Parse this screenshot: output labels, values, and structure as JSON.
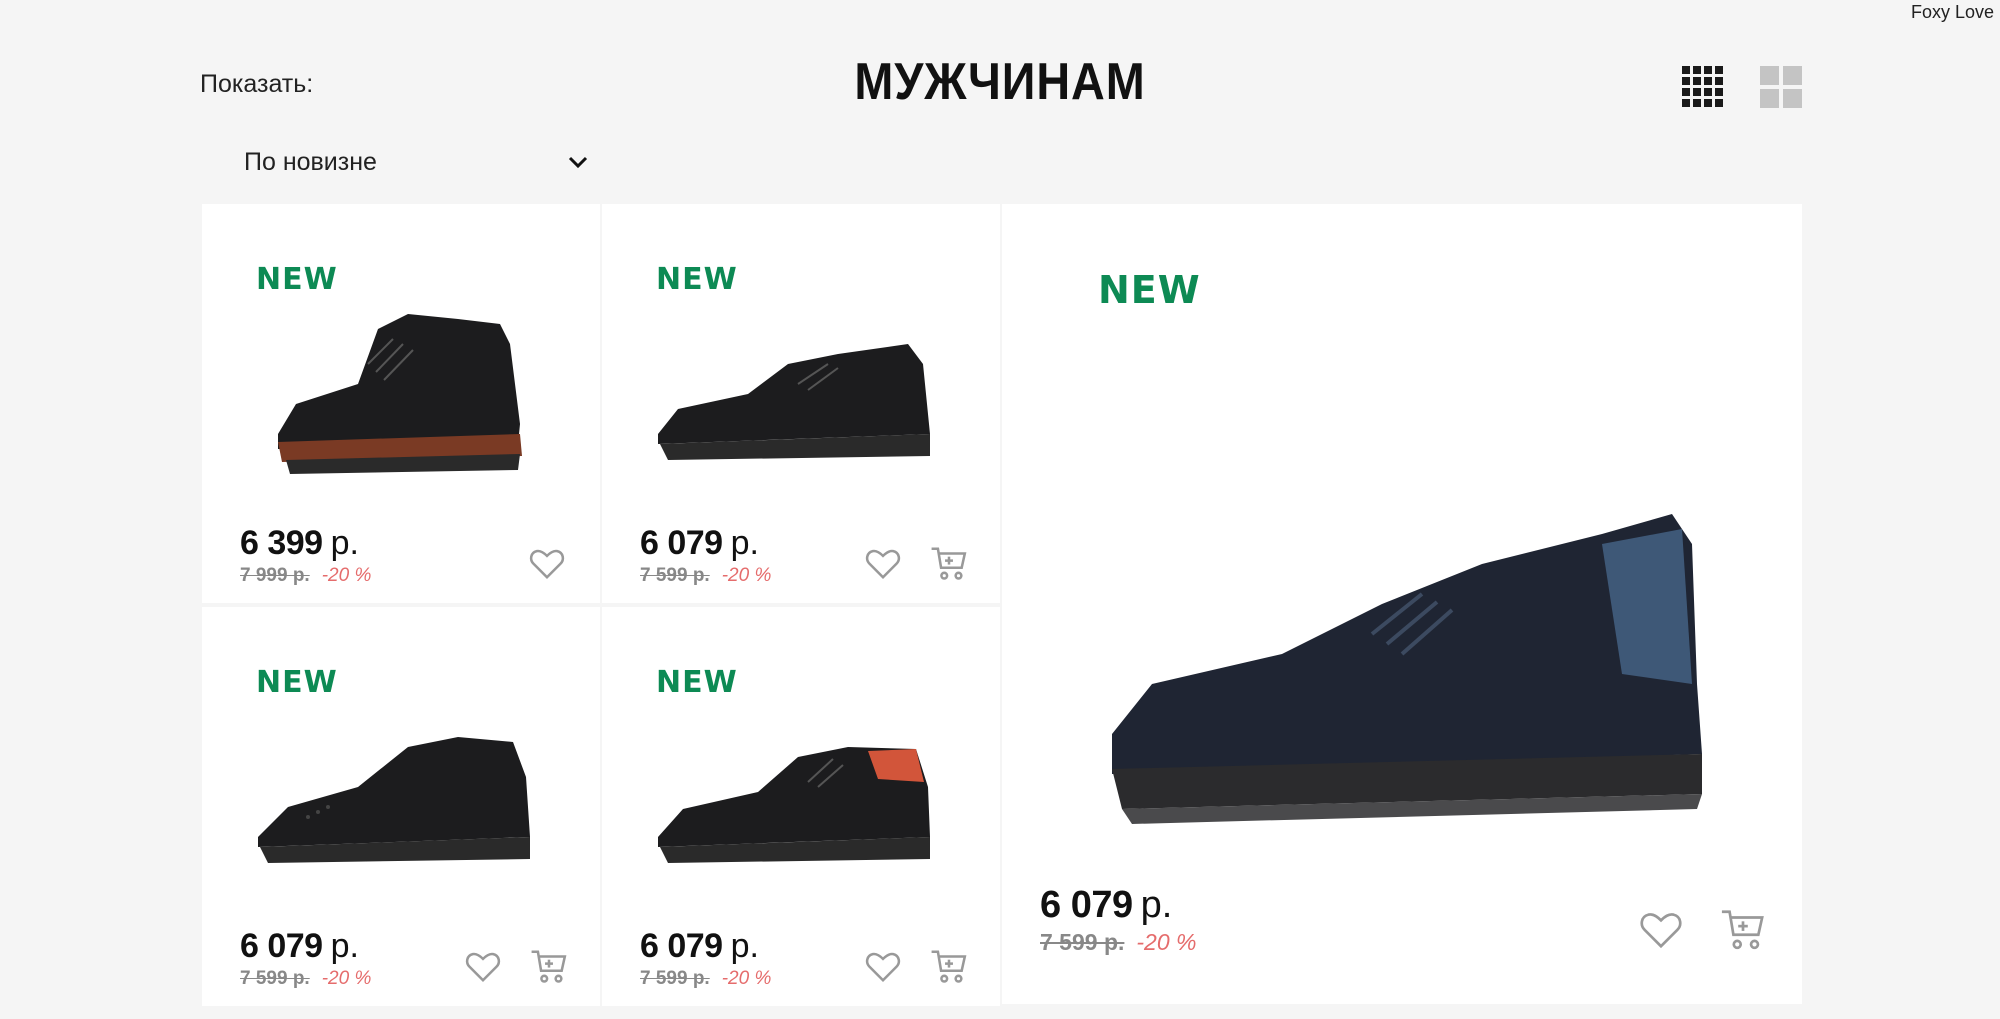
{
  "brand": "Foxy Love",
  "page": {
    "show_label": "Показать:",
    "title": "МУЖЧИНАМ",
    "sort_value": "По новизне"
  },
  "icons": {
    "grid_small": "grid-3x3-icon",
    "grid_large": "grid-2x2-icon",
    "favorite": "heart-icon",
    "cart": "cart-icon",
    "dropdown": "chevron-down-icon"
  },
  "colors": {
    "new_badge": "#0d8a54",
    "discount": "#e56c6c",
    "old_price": "#888888",
    "background": "#f5f5f5"
  },
  "products": [
    {
      "badge": "NEW",
      "price": "6 399",
      "currency": "р.",
      "old_price": "7 999 р.",
      "discount": "-20 %"
    },
    {
      "badge": "NEW",
      "price": "6 079",
      "currency": "р.",
      "old_price": "7 599 р.",
      "discount": "-20 %"
    },
    {
      "badge": "NEW",
      "price": "6 079",
      "currency": "р.",
      "old_price": "7 599 р.",
      "discount": "-20 %"
    },
    {
      "badge": "NEW",
      "price": "6 079",
      "currency": "р.",
      "old_price": "7 599 р.",
      "discount": "-20 %"
    },
    {
      "badge": "NEW",
      "price": "6 079",
      "currency": "р.",
      "old_price": "7 599 р.",
      "discount": "-20 %"
    }
  ]
}
